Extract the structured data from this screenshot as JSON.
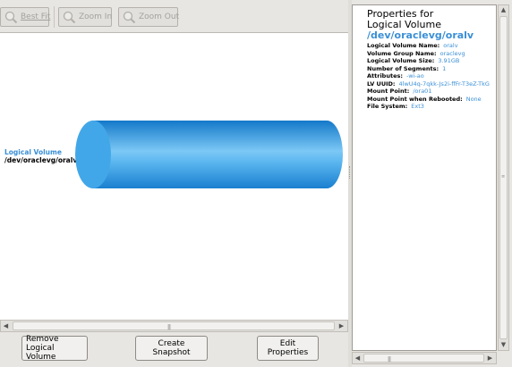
{
  "toolbar": {
    "best_fit": "Best Fit",
    "zoom_in": "Zoom In",
    "zoom_out": "Zoom Out"
  },
  "canvas": {
    "lv_key": "Logical Volume",
    "lv_path": "/dev/oraclevg/oralv"
  },
  "buttons": {
    "remove_line1": "Remove",
    "remove_line2": "Logical Volume",
    "snapshot": "Create Snapshot",
    "edit": "Edit Properties"
  },
  "properties": {
    "title_line1": "Properties for",
    "title_line2": "Logical Volume",
    "title_dev": "/dev/oraclevg/oralv",
    "rows": [
      {
        "key": "Logical Volume Name:",
        "value": "oralv"
      },
      {
        "key": "Volume Group Name:",
        "value": "oraclevg"
      },
      {
        "key": "Logical Volume Size:",
        "value": "3.91GB"
      },
      {
        "key": "Number of Segments:",
        "value": "1"
      },
      {
        "key": "Attributes:",
        "value": "-wi-ao"
      },
      {
        "key": "LV UUID:",
        "value": "4lwU4q-7qkk-Js2i-ffFr-T3eZ-TkG"
      },
      {
        "key": "Mount Point:",
        "value": "/ora01"
      },
      {
        "key": "Mount Point when Rebooted:",
        "value": "None"
      },
      {
        "key": "File System:",
        "value": "Ext3"
      }
    ]
  },
  "colors": {
    "accent": "#3a8fd6",
    "cylinder": "#2f9ee8"
  }
}
